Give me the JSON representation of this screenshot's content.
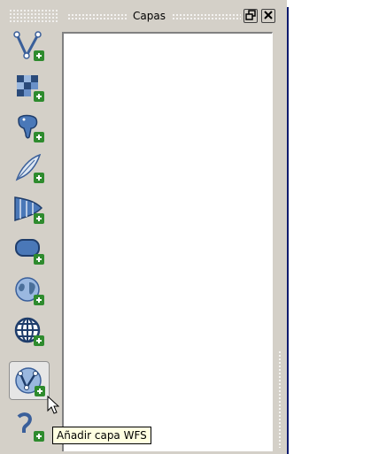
{
  "panel": {
    "title": "Capas",
    "float_icon": "float-icon",
    "close_icon": "close-icon"
  },
  "toolbar": {
    "buttons": [
      {
        "icon": "add-vector-layer-icon"
      },
      {
        "icon": "add-raster-layer-icon"
      },
      {
        "icon": "add-postgis-layer-icon"
      },
      {
        "icon": "add-spatialite-layer-icon"
      },
      {
        "icon": "add-mssql-layer-icon"
      },
      {
        "icon": "add-oracle-layer-icon"
      },
      {
        "icon": "add-wms-layer-icon"
      },
      {
        "icon": "add-wcs-layer-icon"
      },
      {
        "icon": "add-wfs-layer-icon",
        "pressed": true
      },
      {
        "icon": "add-delimited-text-layer-icon"
      }
    ]
  },
  "tooltip": {
    "text": "Añadir capa WFS"
  },
  "colors": {
    "panel_bg": "#d4d0c8",
    "plus_badge": "#2e8b2e",
    "icon_blue": "#4a78b8",
    "tooltip_bg": "#ffffe1",
    "divider": "#0a1a6e"
  }
}
